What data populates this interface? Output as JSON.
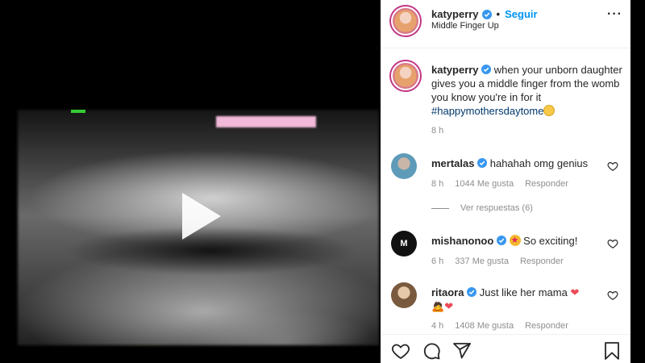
{
  "post": {
    "username": "katyperry",
    "follow_label": "Seguir",
    "separator": "•",
    "audio_title": "Middle Finger Up",
    "more_label": "···"
  },
  "caption": {
    "username": "katyperry",
    "text": "when your unborn daughter gives you a middle finger from the womb you know you're in for it",
    "hashtag": "#happymothersdaytome",
    "time": "8 h"
  },
  "comments": [
    {
      "username": "mertalas",
      "text": "hahahah omg genius",
      "time": "8 h",
      "likes": "1044 Me gusta",
      "reply_label": "Responder",
      "view_replies": "Ver respuestas (6)"
    },
    {
      "username": "mishanonoo",
      "avatar_text": "M",
      "text": "So exciting!",
      "time": "6 h",
      "likes": "337 Me gusta",
      "reply_label": "Responder"
    },
    {
      "username": "ritaora",
      "text": "Just like her mama",
      "time": "4 h",
      "likes": "1408 Me gusta",
      "reply_label": "Responder"
    }
  ],
  "icons": {
    "play": "play-icon",
    "like": "heart-icon",
    "comment": "comment-icon",
    "share": "share-icon",
    "save": "bookmark-icon",
    "verified": "verified-badge-icon"
  },
  "colors": {
    "link_blue": "#0095f6",
    "hashtag": "#00376b",
    "muted": "#8e8e8e",
    "text": "#262626"
  }
}
